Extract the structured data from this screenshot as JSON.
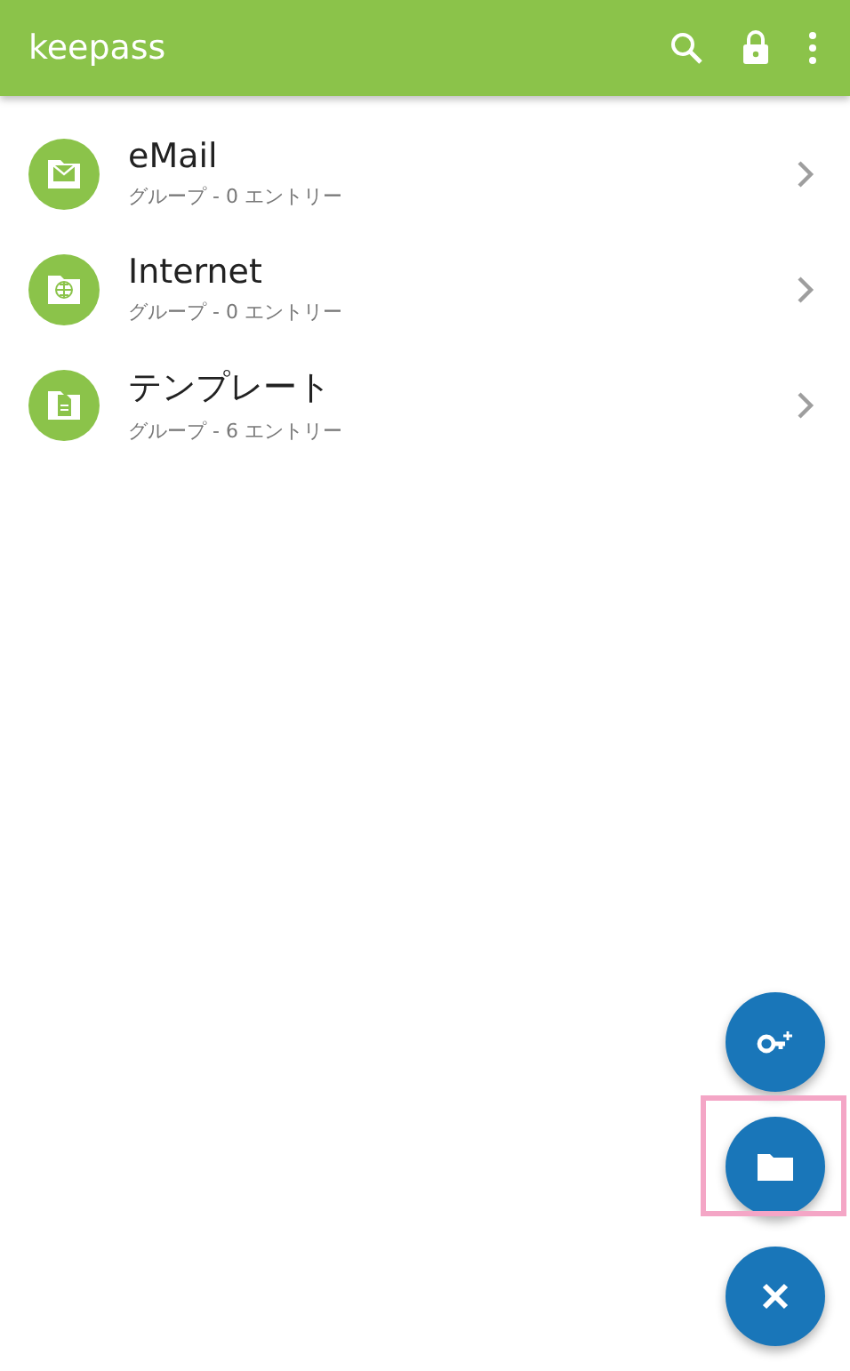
{
  "app_bar": {
    "title": "keepass"
  },
  "groups": [
    {
      "name": "eMail",
      "subtitle": "グループ - 0 エントリー",
      "kind": "mail"
    },
    {
      "name": "Internet",
      "subtitle": "グループ - 0 エントリー",
      "kind": "globe"
    },
    {
      "name": "テンプレート",
      "subtitle": "グループ - 6 エントリー",
      "kind": "document"
    }
  ],
  "fabs": [
    {
      "kind": "add_entry",
      "highlighted": false
    },
    {
      "kind": "add_group",
      "highlighted": true
    },
    {
      "kind": "close",
      "highlighted": false
    }
  ]
}
